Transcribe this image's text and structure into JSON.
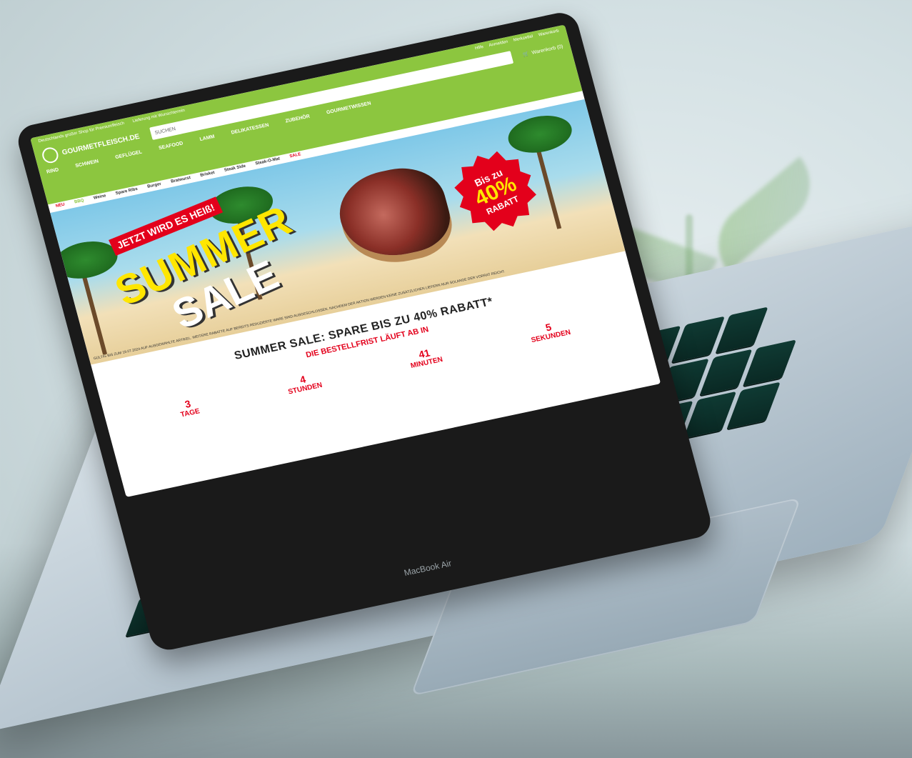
{
  "device": {
    "model_label": "MacBook Air"
  },
  "site": {
    "topbar": {
      "usps": [
        "Deutschlands großer Shop für Premiumfleisch",
        "Lieferung mit Wunschtermin"
      ],
      "links": [
        "Hilfe",
        "Anmelden",
        "Merkzettel",
        "Warenkorb"
      ]
    },
    "logo_text": "GOURMETFLEISCH.DE",
    "search": {
      "placeholder": "SUCHEN"
    },
    "cart": {
      "label": "Warenkorb (0)"
    },
    "nav": [
      "RIND",
      "SCHWEIN",
      "GEFLÜGEL",
      "SEAFOOD",
      "LAMM",
      "DELIKATESSEN",
      "ZUBEHÖR",
      "GOURMETWISSEN"
    ],
    "subnav": [
      {
        "label": "NEU",
        "class": "red"
      },
      {
        "label": "BBQ",
        "class": "green"
      },
      {
        "label": "Weine",
        "class": ""
      },
      {
        "label": "Spare Ribs",
        "class": ""
      },
      {
        "label": "Burger",
        "class": ""
      },
      {
        "label": "Bratwurst",
        "class": ""
      },
      {
        "label": "Brisket",
        "class": ""
      },
      {
        "label": "Steak Side",
        "class": ""
      },
      {
        "label": "Steak-O-Mat",
        "class": ""
      },
      {
        "label": "SALE",
        "class": "red"
      }
    ],
    "hero": {
      "tagline": "JETZT WIRD ES HEIß!",
      "headline_1": "SUMMER",
      "headline_2": "SALE",
      "badge_line1": "Bis zu",
      "badge_line2": "40%",
      "badge_line3": "RABATT",
      "fineprint": "GÜLTIG BIS ZUM 19.07.2024 AUF AUSGEWÄHLTE ARTIKEL. WEITERE RABATTE AUF BEREITS REDUZIERTE WARE SIND AUSGESCHLOSSEN. NACHDEM DER AKTION WERDEN KEINE ZUSÄTZLICHEN LIEFERN NUR SOLANGE DER VORRAT REICHT."
    },
    "countdown": {
      "title": "SUMMER SALE: SPARE BIS ZU 40% RABATT*",
      "subtitle": "DIE BESTELLFRIST LÄUFT AB IN",
      "items": [
        {
          "value": "3",
          "label": "TAGE"
        },
        {
          "value": "4",
          "label": "STUNDEN"
        },
        {
          "value": "41",
          "label": "MINUTEN"
        },
        {
          "value": "5",
          "label": "SEKUNDEN"
        }
      ]
    }
  }
}
